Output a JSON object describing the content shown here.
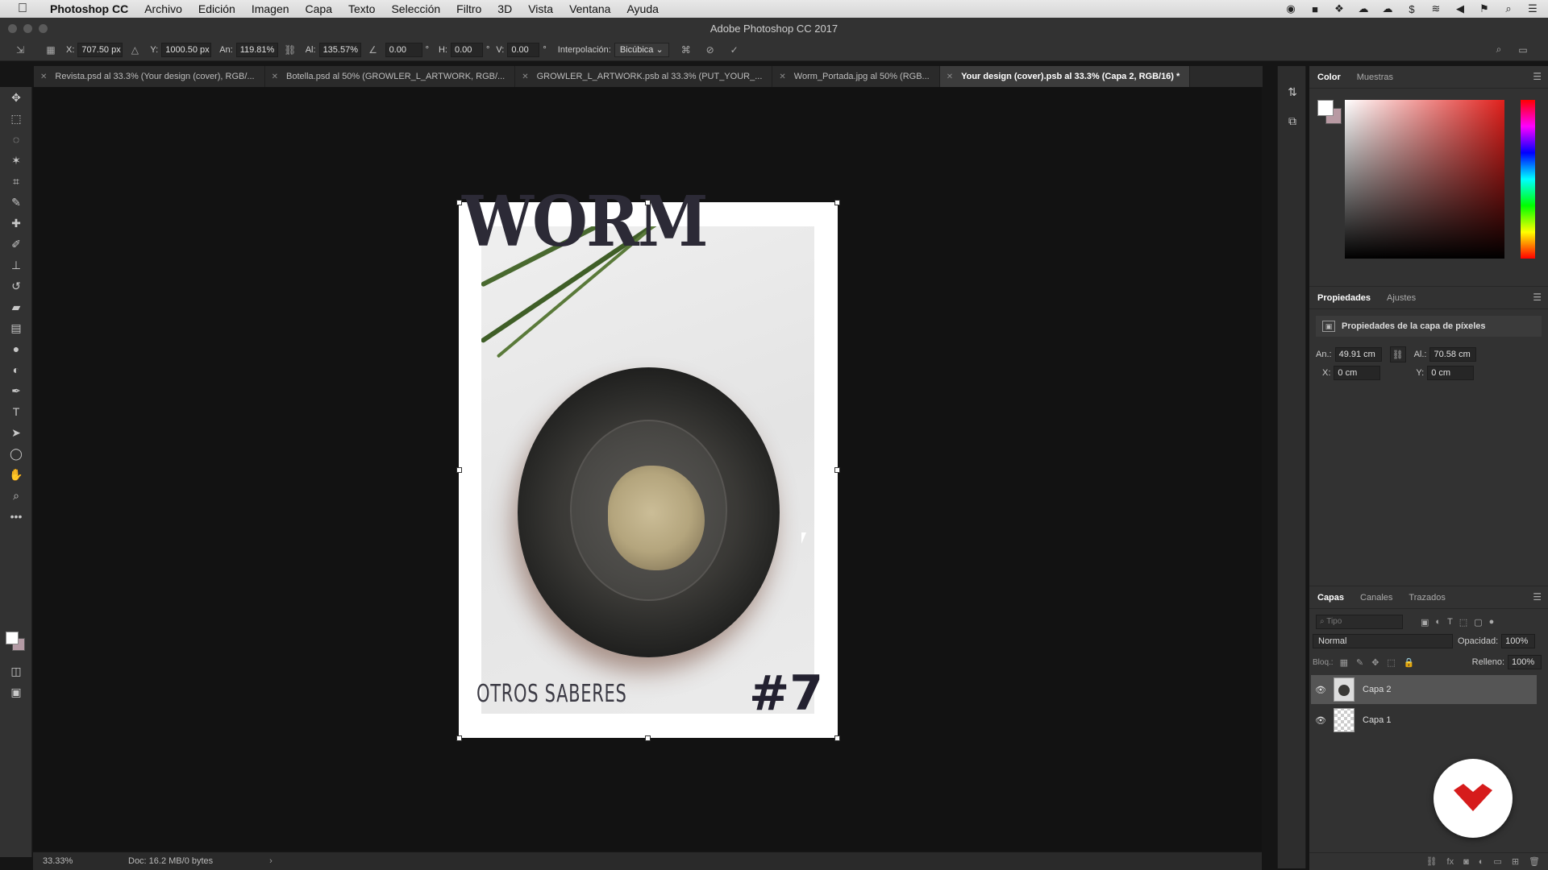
{
  "menubar": {
    "app_name": "Photoshop CC",
    "items": [
      "Archivo",
      "Edición",
      "Imagen",
      "Capa",
      "Texto",
      "Selección",
      "Filtro",
      "3D",
      "Vista",
      "Ventana",
      "Ayuda"
    ]
  },
  "window": {
    "title": "Adobe Photoshop CC 2017"
  },
  "options": {
    "x_label": "X:",
    "x_value": "707.50 px",
    "y_label": "Y:",
    "y_value": "1000.50 px",
    "w_label": "An:",
    "w_value": "119.81%",
    "h_label": "Al:",
    "h_value": "135.57%",
    "angle_value": "0.00",
    "hskew_label": "H:",
    "hskew_value": "0.00",
    "vskew_label": "V:",
    "vskew_value": "0.00",
    "degree_symbol": "°",
    "interp_label": "Interpolación:",
    "interp_value": "Bicúbica"
  },
  "tabs": [
    {
      "label": "Revista.psd al 33.3% (Your design (cover), RGB/..."
    },
    {
      "label": "Botella.psd al 50% (GROWLER_L_ARTWORK, RGB/..."
    },
    {
      "label": "GROWLER_L_ARTWORK.psb al 33.3% (PUT_YOUR_..."
    },
    {
      "label": "Worm_Portada.jpg al 50% (RGB..."
    },
    {
      "label": "Your design (cover).psb al 33.3% (Capa 2, RGB/16) *"
    }
  ],
  "document": {
    "title_text": "WORM",
    "subtitle_text": "OTROS SABERES",
    "issue_text": "#7"
  },
  "status": {
    "zoom": "33.33%",
    "doc_info": "Doc: 16.2 MB/0 bytes",
    "arrow": "›"
  },
  "color_panel": {
    "tabs": [
      "Color",
      "Muestras"
    ],
    "foreground": "#ffffff",
    "background": "#b89aa3"
  },
  "properties_panel": {
    "tabs": [
      "Propiedades",
      "Ajustes"
    ],
    "header": "Propiedades de la capa de píxeles",
    "w_label": "An.:",
    "w_value": "49.91 cm",
    "h_label": "Al.:",
    "h_value": "70.58 cm",
    "x_label": "X:",
    "x_value": "0 cm",
    "y_label": "Y:",
    "y_value": "0 cm"
  },
  "layers_panel": {
    "tabs": [
      "Capas",
      "Canales",
      "Trazados"
    ],
    "filter_placeholder": "Tipo",
    "blend_mode": "Normal",
    "opacity_label": "Opacidad:",
    "opacity_value": "100%",
    "lock_label": "Bloq.:",
    "fill_label": "Relleno:",
    "fill_value": "100%",
    "layers": [
      {
        "name": "Capa 2",
        "selected": true
      },
      {
        "name": "Capa 1",
        "selected": false
      }
    ]
  }
}
